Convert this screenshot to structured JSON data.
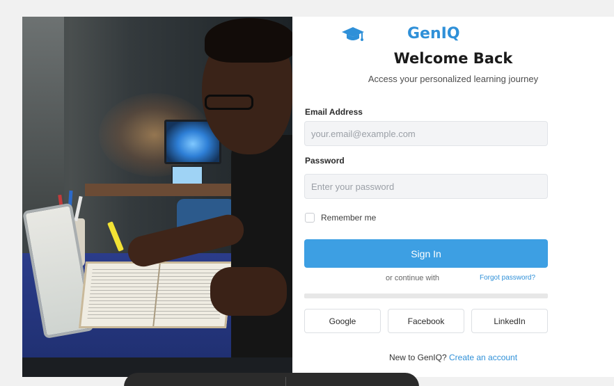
{
  "brand": {
    "name": "GenIQ",
    "icon": "graduation-cap-icon",
    "color": "#2f90d8"
  },
  "header": {
    "title": "Welcome Back",
    "subtitle": "Access your personalized learning journey"
  },
  "form": {
    "email": {
      "label": "Email Address",
      "placeholder": "your.email@example.com",
      "value": ""
    },
    "password": {
      "label": "Password",
      "placeholder": "Enter your password",
      "value": ""
    },
    "remember": {
      "label": "Remember me",
      "checked": false
    },
    "submit_label": "Sign In",
    "continue_text": "or continue with",
    "forgot_label": "Forgot password?"
  },
  "social": [
    {
      "label": "Google"
    },
    {
      "label": "Facebook"
    },
    {
      "label": "LinkedIn"
    }
  ],
  "footer": {
    "prompt": "New to GenIQ?",
    "link_label": "Create an account"
  },
  "colors": {
    "accent": "#3d9fe3",
    "link": "#2f90d8",
    "background": "#f1f1f1"
  }
}
